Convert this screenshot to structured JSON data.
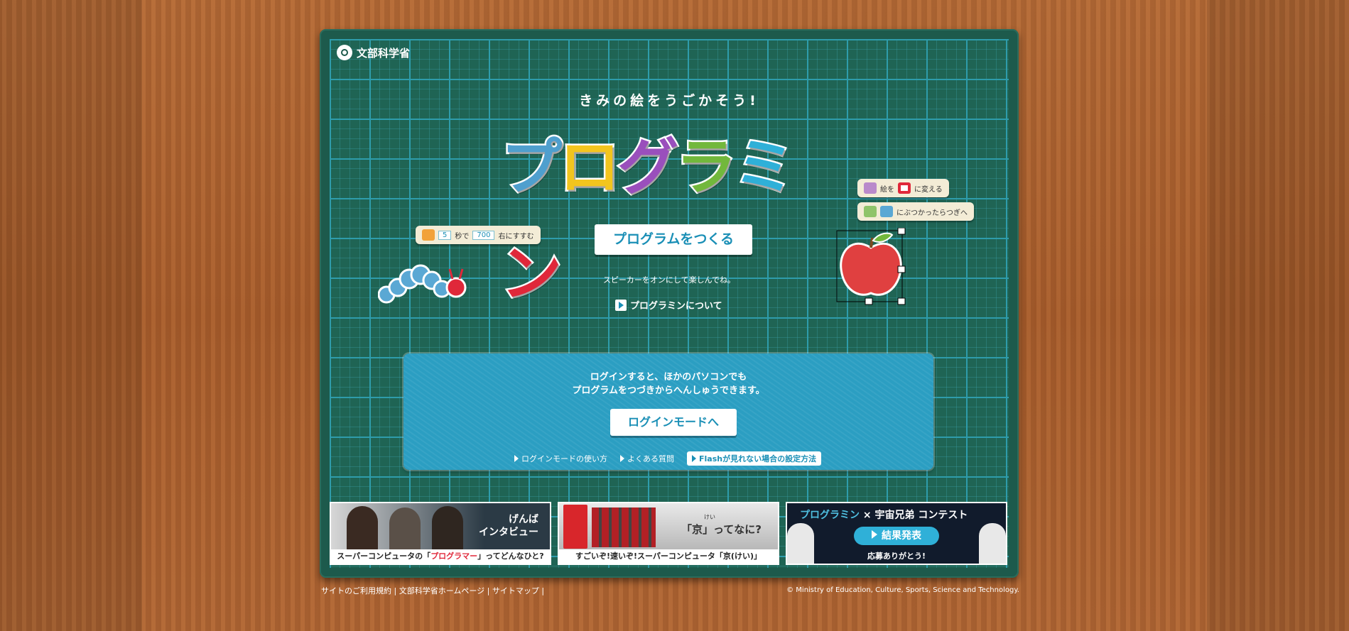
{
  "ministry": {
    "name": "文部科学省"
  },
  "tagline": "きみの絵をうごかそう!",
  "logo": {
    "chars": [
      "プ",
      "ロ",
      "グ",
      "ラ",
      "ミ",
      "ン"
    ],
    "colors": [
      "#4f9fce",
      "#f3c51e",
      "#9a4fbc",
      "#72b83c",
      "#2fb0d8",
      "#e0283a"
    ]
  },
  "blocks": {
    "move": {
      "seconds": "5",
      "sec_label": "秒で",
      "distance": "700",
      "suffix": "右にすすむ"
    },
    "change": {
      "prefix": "絵を",
      "suffix": "に変える"
    },
    "collide": {
      "suffix": "にぶつかったらつぎへ"
    }
  },
  "create_button": "プログラムをつくる",
  "speaker_note": "スピーカーをオンにして楽しんでね。",
  "about_link": "プログラミンについて",
  "login": {
    "text1": "ログインすると、ほかのパソコンでも",
    "text2": "プログラムをつづきからへんしゅうできます。",
    "button": "ログインモードへ",
    "links": [
      "ログインモードの使い方",
      "よくある質問"
    ],
    "flash_link": "Flashが見れない場合の設定方法"
  },
  "banners": [
    {
      "overlay": "げんば\nインタビュー",
      "caption_pre": "スーパーコンピュータの「",
      "caption_em": "プログラマー",
      "caption_post": "」ってどんなひと?"
    },
    {
      "overlay": "「京」ってなに?",
      "ruby": "けい",
      "caption": "すごいぞ!速いぞ!スーパーコンピュータ「京(けい)」"
    },
    {
      "title_logo": "プログラミン",
      "title_x": "×",
      "title_rest": "宇宙兄弟 コンテスト",
      "button": "結果発表",
      "thanks": "応募ありがとう!"
    }
  ],
  "footer": {
    "links": [
      "サイトのご利用規約",
      "文部科学省ホームページ",
      "サイトマップ"
    ],
    "copyright": "© Ministry of Education, Culture, Sports, Science and Technology."
  },
  "colors": {
    "board": "#1d5a4c",
    "grid": "#2e9cab",
    "panel": "#2b9ec2",
    "accent": "#1a8fb6"
  }
}
